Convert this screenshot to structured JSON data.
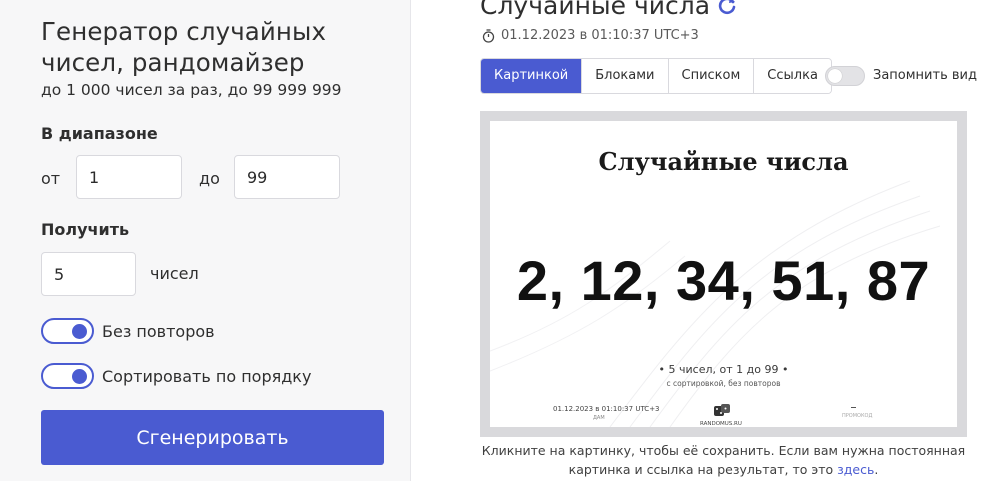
{
  "left_panel": {
    "title": "Генератор случайных чисел, рандомайзер",
    "subtitle": "до 1 000 чисел за раз, до 99 999 999",
    "range": {
      "label": "В диапазоне",
      "from_label": "от",
      "from_value": "1",
      "to_label": "до",
      "to_value": "99"
    },
    "count": {
      "label": "Получить",
      "value": "5",
      "unit_label": "чисел"
    },
    "toggles": [
      {
        "label": "Без повторов",
        "on": true
      },
      {
        "label": "Сортировать по порядку",
        "on": true
      }
    ],
    "generate_label": "Сгенерировать"
  },
  "result": {
    "title": "Случайные числа",
    "refresh_icon": "refresh-icon",
    "timestamp_icon": "stopwatch-icon",
    "timestamp": "01.12.2023 в 01:10:37 UTC+3",
    "tabs": [
      "Картинкой",
      "Блоками",
      "Списком",
      "Ссылка"
    ],
    "active_tab": "Картинкой",
    "remember_label": "Запомнить вид",
    "card": {
      "heading": "Случайные числа",
      "numbers": "2, 12, 34, 51, 87",
      "summary": "• 5 чисел, от 1 до 99 •",
      "note": "с сортировкой, без повторов",
      "date": "01.12.2023 в 01:10:37 UTC+3",
      "date_sub": "ДАМ",
      "brand": "RANDOMUS.RU",
      "promo": "ПРОМОКОД"
    },
    "caption_line1": "Кликните на картинку, чтобы её сохранить. Если вам нужна постоянная",
    "caption_line2": "картинка и ссылка на результат, то это",
    "caption_link": "здесь",
    "caption_end": "."
  },
  "colors": {
    "accent": "#4a5bd1",
    "panel_bg": "#f7f7f8",
    "frame_bg": "#d9d9dc"
  }
}
